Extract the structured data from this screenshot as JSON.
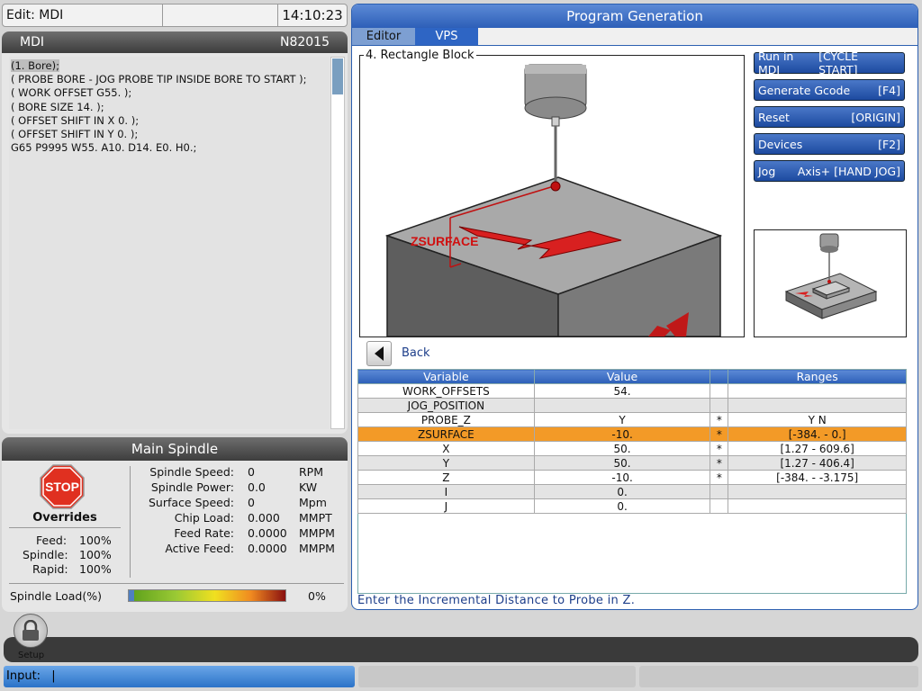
{
  "topbar": {
    "mode": "Edit: MDI",
    "clock": "14:10:23"
  },
  "mdi": {
    "title": "MDI",
    "program": "N82015",
    "lines": [
      "(1. Bore);",
      "( PROBE BORE - JOG PROBE TIP INSIDE BORE TO START );",
      "( WORK OFFSET G55. );",
      "( BORE SIZE 14. );",
      "( OFFSET SHIFT IN X 0. );",
      "( OFFSET SHIFT IN Y 0. );",
      "G65 P9995 W55. A10. D14. E0. H0.;"
    ]
  },
  "spindle": {
    "title": "Main Spindle",
    "stop_label": "STOP",
    "overrides_title": "Overrides",
    "overrides": [
      {
        "label": "Feed:",
        "value": "100%"
      },
      {
        "label": "Spindle:",
        "value": "100%"
      },
      {
        "label": "Rapid:",
        "value": "100%"
      }
    ],
    "stats": [
      {
        "label": "Spindle Speed:",
        "value": "0",
        "unit": "RPM"
      },
      {
        "label": "Spindle Power:",
        "value": "0.0",
        "unit": "KW"
      },
      {
        "label": "Surface Speed:",
        "value": "0",
        "unit": "Mpm"
      },
      {
        "label": "Chip Load:",
        "value": "0.000",
        "unit": "MMPT"
      },
      {
        "label": "Feed Rate:",
        "value": "0.0000",
        "unit": "MMPM"
      },
      {
        "label": "Active Feed:",
        "value": "0.0000",
        "unit": "MMPM"
      }
    ],
    "load_label": "Spindle Load(%)",
    "load_value": "0%",
    "load_fraction": 0
  },
  "progen": {
    "title": "Program Generation",
    "tabs": [
      "Editor",
      "VPS"
    ],
    "active_tab": "VPS",
    "image_caption": "4. Rectangle Block",
    "image_annotation": "ZSURFACE",
    "buttons": [
      {
        "label": "Run in MDI",
        "key": "[CYCLE START]"
      },
      {
        "label": "Generate Gcode",
        "key": "[F4]"
      },
      {
        "label": "Reset",
        "key": "[ORIGIN]"
      },
      {
        "label": "Devices",
        "key": "[F2]"
      },
      {
        "label": "Jog",
        "key": "Axis+ [HAND JOG]"
      }
    ],
    "back_label": "Back",
    "table": {
      "headers": [
        "Variable",
        "Value",
        "",
        "Ranges"
      ],
      "rows": [
        {
          "variable": "WORK_OFFSETS",
          "value": "54.",
          "flag": "",
          "range": ""
        },
        {
          "variable": "JOG_POSITION",
          "value": "",
          "flag": "",
          "range": ""
        },
        {
          "variable": "PROBE_Z",
          "value": "Y",
          "flag": "*",
          "range": "Y N"
        },
        {
          "variable": "ZSURFACE",
          "value": "-10.",
          "flag": "*",
          "range": "[-384. - 0.]"
        },
        {
          "variable": "X",
          "value": "50.",
          "flag": "*",
          "range": "[1.27 - 609.6]"
        },
        {
          "variable": "Y",
          "value": "50.",
          "flag": "*",
          "range": "[1.27 - 406.4]"
        },
        {
          "variable": "Z",
          "value": "-10.",
          "flag": "*",
          "range": "[-384. - -3.175]"
        },
        {
          "variable": "I",
          "value": "0.",
          "flag": "",
          "range": ""
        },
        {
          "variable": "J",
          "value": "0.",
          "flag": "",
          "range": ""
        }
      ],
      "selected_row": 3
    },
    "hint": "Enter the Incremental Distance to Probe in Z."
  },
  "setup": {
    "label": "Setup"
  },
  "input": {
    "label": "Input:",
    "value": "|"
  },
  "colors": {
    "accent_blue": "#2d5fb8",
    "selected_row": "#f39a27",
    "stop_red": "#e03020"
  }
}
